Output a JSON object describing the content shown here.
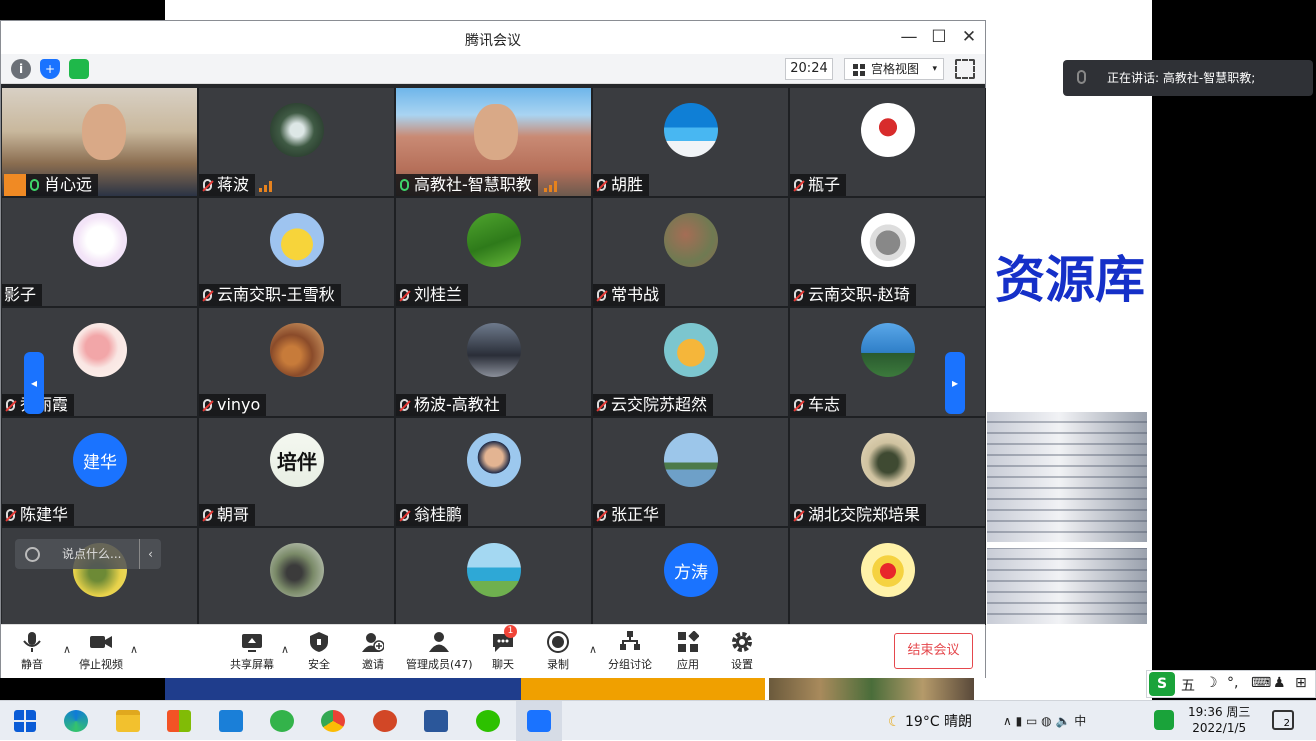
{
  "window": {
    "title": "腾讯会议",
    "minimize": "—",
    "maximize": "☐",
    "close": "✕"
  },
  "toolbar": {
    "clock": "20:24",
    "view_label": "宫格视图",
    "view_caret": "▾"
  },
  "slide": {
    "title_fragment": "资源库"
  },
  "participants": [
    {
      "name": "肖心远",
      "mic": "on",
      "av": "video"
    },
    {
      "name": "蒋波",
      "mic": "muted",
      "av": "waterfall",
      "signal": true
    },
    {
      "name": "高教社-智慧职教",
      "mic": "on",
      "av": "video2",
      "signal": true
    },
    {
      "name": "胡胜",
      "mic": "muted",
      "av": "beach"
    },
    {
      "name": "瓶子",
      "mic": "muted",
      "av": "cartoon-red"
    },
    {
      "name": "影子",
      "mic": "none",
      "av": "cartoon-white"
    },
    {
      "name": "云南交职-王雪秋",
      "mic": "muted",
      "av": "pikachu"
    },
    {
      "name": "刘桂兰",
      "mic": "muted",
      "av": "green"
    },
    {
      "name": "常书战",
      "mic": "muted",
      "av": "rocks"
    },
    {
      "name": "云南交职-赵琦",
      "mic": "muted",
      "av": "cat"
    },
    {
      "name": "乔丽霞",
      "mic": "muted",
      "av": "flower"
    },
    {
      "name": "vinyo",
      "mic": "muted",
      "av": "people"
    },
    {
      "name": "杨波-高教社",
      "mic": "muted",
      "av": "bike"
    },
    {
      "name": "云交院苏超然",
      "mic": "muted",
      "av": "catcartoon"
    },
    {
      "name": "车志",
      "mic": "muted",
      "av": "palm"
    },
    {
      "name": "陈建华",
      "mic": "muted",
      "av": "text",
      "avtext": "建华"
    },
    {
      "name": "朝哥",
      "mic": "muted",
      "av": "calligraphy",
      "avtext": "培伴"
    },
    {
      "name": "翁桂鹏",
      "mic": "muted",
      "av": "portrait"
    },
    {
      "name": "张正华",
      "mic": "muted",
      "av": "lake"
    },
    {
      "name": "湖北交院郑培果",
      "mic": "muted",
      "av": "rider"
    },
    {
      "name": "",
      "mic": "muted",
      "av": "child"
    },
    {
      "name": "",
      "mic": "muted",
      "av": "person"
    },
    {
      "name": "",
      "mic": "muted",
      "av": "sea"
    },
    {
      "name": "",
      "mic": "muted",
      "av": "text",
      "avtext": "方涛"
    },
    {
      "name": "",
      "mic": "muted",
      "av": "tiger"
    }
  ],
  "nav": {
    "prev": "◂",
    "next": "▸"
  },
  "comment": {
    "placeholder": "说点什么...",
    "collapse": "‹"
  },
  "bottombar": {
    "mute": "静音",
    "stop_video": "停止视频",
    "share": "共享屏幕",
    "security": "安全",
    "invite": "邀请",
    "members": "管理成员(47)",
    "chat": "聊天",
    "chat_badge": "1",
    "record": "录制",
    "breakout": "分组讨论",
    "apps": "应用",
    "settings": "设置",
    "end": "结束会议"
  },
  "speaking": {
    "text": "正在讲话: 高教社-智慧职教;"
  },
  "ime": {
    "logo": "S",
    "mode": "五",
    "moon": "☽",
    "punct": "°,",
    "kbd": "⌨",
    "user": "♟",
    "grid": "⊞"
  },
  "taskbar": {
    "weather_icon": "☾",
    "weather": "19°C  晴朗",
    "tray": "∧  ▮  ▭  ◍  🔈  中",
    "time": "19:36 周三",
    "date": "2022/1/5",
    "notifications": "2"
  }
}
